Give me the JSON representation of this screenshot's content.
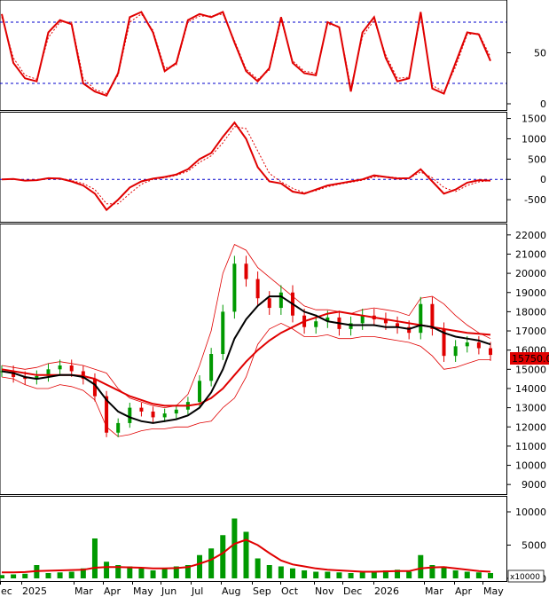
{
  "price_tag": "15750.00",
  "volume_unit": "x10000",
  "colors": {
    "main_line": "#e00000",
    "ma_black": "#000000",
    "up_candle": "#009900",
    "down_candle": "#e00000",
    "volume_bar": "#009900",
    "ref_line": "#0000cc",
    "bg": "#ffffff"
  },
  "x_axis": {
    "labels": [
      "ec",
      "2025",
      "Mar",
      "Apr",
      "May",
      "Jun",
      "Jul",
      "Aug",
      "Sep",
      "Oct",
      "Nov",
      "Dec",
      "2026",
      "Mar",
      "Apr",
      "May"
    ]
  },
  "chart_data": [
    {
      "type": "line",
      "panel": "stochastic",
      "ylim": [
        0,
        100
      ],
      "y_ticks": [
        "50",
        "0"
      ],
      "reference_lines": [
        80,
        20
      ],
      "series": [
        {
          "values": [
            88,
            40,
            25,
            22,
            70,
            82,
            78,
            20,
            12,
            8,
            30,
            85,
            90,
            70,
            32,
            40,
            82,
            88,
            85,
            90,
            60,
            32,
            22,
            35,
            85,
            40,
            30,
            28,
            80,
            75,
            12,
            70,
            85,
            45,
            22,
            25,
            90,
            15,
            10,
            40,
            70,
            68,
            42
          ]
        },
        {
          "values": [
            85,
            45,
            28,
            24,
            65,
            80,
            80,
            25,
            14,
            10,
            28,
            80,
            88,
            72,
            35,
            38,
            80,
            86,
            86,
            88,
            62,
            34,
            24,
            33,
            82,
            42,
            32,
            30,
            78,
            76,
            16,
            66,
            82,
            48,
            25,
            26,
            86,
            18,
            12,
            36,
            68,
            69,
            46
          ]
        }
      ]
    },
    {
      "type": "line",
      "panel": "macd",
      "ylim": [
        -1000,
        1600
      ],
      "y_ticks": [
        "1500",
        "1000",
        "500",
        "0",
        "-500"
      ],
      "reference_lines": [
        0
      ],
      "series": [
        {
          "values": [
            0,
            10,
            -30,
            -20,
            30,
            20,
            -50,
            -150,
            -350,
            -750,
            -500,
            -200,
            -50,
            20,
            60,
            120,
            250,
            500,
            650,
            1050,
            1400,
            1000,
            300,
            -50,
            -100,
            -300,
            -350,
            -250,
            -150,
            -100,
            -50,
            0,
            100,
            60,
            20,
            30,
            250,
            -50,
            -350,
            -250,
            -80,
            -20,
            -30
          ]
        },
        {
          "values": [
            5,
            5,
            -20,
            -15,
            25,
            20,
            -30,
            -100,
            -250,
            -600,
            -600,
            -350,
            -120,
            0,
            40,
            100,
            200,
            420,
            580,
            900,
            1300,
            1250,
            700,
            150,
            -60,
            -220,
            -330,
            -280,
            -180,
            -120,
            -70,
            -20,
            60,
            70,
            40,
            30,
            180,
            40,
            -200,
            -300,
            -150,
            -60,
            -30
          ]
        }
      ]
    },
    {
      "type": "candlestick",
      "panel": "price",
      "ylim": [
        8500,
        22500
      ],
      "y_ticks": [
        "22000",
        "21000",
        "20000",
        "19000",
        "18000",
        "17000",
        "16000",
        "15000",
        "14000",
        "13000",
        "12000",
        "11000",
        "10000",
        "9000"
      ],
      "close": [
        14900,
        14600,
        14500,
        14650,
        15000,
        15200,
        14900,
        14500,
        13600,
        11700,
        12200,
        13000,
        12800,
        12500,
        12700,
        12900,
        13300,
        14400,
        15800,
        18000,
        20500,
        19700,
        18700,
        18200,
        19000,
        17800,
        17200,
        17500,
        17700,
        17100,
        17400,
        17800,
        17600,
        17400,
        17200,
        16900,
        18400,
        17100,
        15700,
        16200,
        16400,
        16100,
        15750
      ],
      "ma_black": [
        14900,
        14800,
        14600,
        14500,
        14600,
        14700,
        14700,
        14600,
        14200,
        13400,
        12800,
        12500,
        12300,
        12200,
        12300,
        12400,
        12600,
        13000,
        13800,
        15000,
        16600,
        17600,
        18300,
        18800,
        18800,
        18400,
        18000,
        17800,
        17500,
        17400,
        17300,
        17300,
        17300,
        17200,
        17200,
        17100,
        17300,
        17200,
        16900,
        16700,
        16600,
        16500,
        16300
      ],
      "ma_red": [
        15000,
        14900,
        14800,
        14700,
        14700,
        14700,
        14700,
        14650,
        14500,
        14200,
        13900,
        13600,
        13400,
        13200,
        13100,
        13100,
        13100,
        13200,
        13500,
        14000,
        14700,
        15400,
        16000,
        16500,
        16900,
        17200,
        17500,
        17700,
        17900,
        18000,
        17900,
        17800,
        17700,
        17600,
        17500,
        17400,
        17300,
        17200,
        17100,
        17000,
        16900,
        16850,
        16800
      ],
      "bb_upper": [
        15200,
        15100,
        15000,
        15100,
        15300,
        15400,
        15300,
        15200,
        15000,
        14800,
        14000,
        13500,
        13300,
        13100,
        13000,
        13100,
        13700,
        15200,
        17000,
        20000,
        21500,
        21200,
        20300,
        19800,
        19300,
        18800,
        18300,
        18100,
        18100,
        18000,
        17900,
        18100,
        18200,
        18100,
        18000,
        17800,
        18700,
        18800,
        18400,
        17800,
        17300,
        16900,
        16600
      ],
      "bb_lower": [
        14600,
        14500,
        14200,
        14000,
        14000,
        14200,
        14100,
        13900,
        13400,
        12000,
        11500,
        11600,
        11800,
        11900,
        11900,
        12000,
        12000,
        12200,
        12300,
        13000,
        13500,
        14600,
        16300,
        17100,
        17400,
        17100,
        16700,
        16700,
        16800,
        16600,
        16600,
        16700,
        16700,
        16600,
        16500,
        16400,
        16200,
        15700,
        15000,
        15100,
        15300,
        15500,
        15500
      ],
      "last_price": 15750
    },
    {
      "type": "bar",
      "panel": "volume",
      "ylim": [
        0,
        12000
      ],
      "y_ticks": [
        "10000",
        "5000",
        "0"
      ],
      "values": [
        500,
        600,
        700,
        2000,
        800,
        900,
        1000,
        1500,
        6000,
        2500,
        2000,
        1800,
        1500,
        1200,
        1500,
        1800,
        2000,
        3500,
        4500,
        6500,
        9000,
        7000,
        3000,
        2000,
        1800,
        1500,
        1200,
        1000,
        1000,
        900,
        800,
        900,
        1000,
        1200,
        1300,
        1000,
        3500,
        2000,
        1800,
        1200,
        1000,
        900,
        800
      ],
      "ma": [
        900,
        900,
        950,
        1100,
        1150,
        1200,
        1250,
        1300,
        1600,
        1700,
        1700,
        1650,
        1600,
        1500,
        1500,
        1550,
        1700,
        2200,
        2800,
        3800,
        5200,
        5800,
        5000,
        3800,
        2700,
        2100,
        1800,
        1500,
        1300,
        1200,
        1100,
        1000,
        1000,
        1050,
        1100,
        1100,
        1500,
        1650,
        1700,
        1500,
        1300,
        1100,
        1000
      ]
    }
  ]
}
